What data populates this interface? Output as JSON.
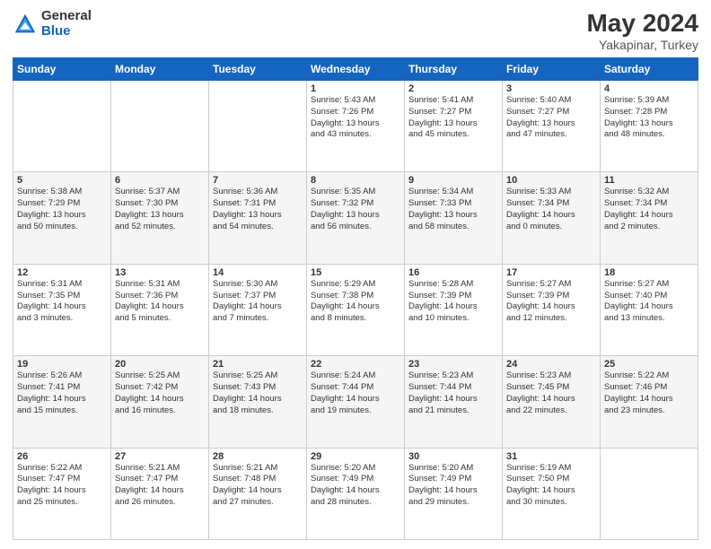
{
  "logo": {
    "general": "General",
    "blue": "Blue"
  },
  "title": "May 2024",
  "subtitle": "Yakapinar, Turkey",
  "days": [
    "Sunday",
    "Monday",
    "Tuesday",
    "Wednesday",
    "Thursday",
    "Friday",
    "Saturday"
  ],
  "weeks": [
    [
      {
        "num": "",
        "text": ""
      },
      {
        "num": "",
        "text": ""
      },
      {
        "num": "",
        "text": ""
      },
      {
        "num": "1",
        "text": "Sunrise: 5:43 AM\nSunset: 7:26 PM\nDaylight: 13 hours\nand 43 minutes."
      },
      {
        "num": "2",
        "text": "Sunrise: 5:41 AM\nSunset: 7:27 PM\nDaylight: 13 hours\nand 45 minutes."
      },
      {
        "num": "3",
        "text": "Sunrise: 5:40 AM\nSunset: 7:27 PM\nDaylight: 13 hours\nand 47 minutes."
      },
      {
        "num": "4",
        "text": "Sunrise: 5:39 AM\nSunset: 7:28 PM\nDaylight: 13 hours\nand 48 minutes."
      }
    ],
    [
      {
        "num": "5",
        "text": "Sunrise: 5:38 AM\nSunset: 7:29 PM\nDaylight: 13 hours\nand 50 minutes."
      },
      {
        "num": "6",
        "text": "Sunrise: 5:37 AM\nSunset: 7:30 PM\nDaylight: 13 hours\nand 52 minutes."
      },
      {
        "num": "7",
        "text": "Sunrise: 5:36 AM\nSunset: 7:31 PM\nDaylight: 13 hours\nand 54 minutes."
      },
      {
        "num": "8",
        "text": "Sunrise: 5:35 AM\nSunset: 7:32 PM\nDaylight: 13 hours\nand 56 minutes."
      },
      {
        "num": "9",
        "text": "Sunrise: 5:34 AM\nSunset: 7:33 PM\nDaylight: 13 hours\nand 58 minutes."
      },
      {
        "num": "10",
        "text": "Sunrise: 5:33 AM\nSunset: 7:34 PM\nDaylight: 14 hours\nand 0 minutes."
      },
      {
        "num": "11",
        "text": "Sunrise: 5:32 AM\nSunset: 7:34 PM\nDaylight: 14 hours\nand 2 minutes."
      }
    ],
    [
      {
        "num": "12",
        "text": "Sunrise: 5:31 AM\nSunset: 7:35 PM\nDaylight: 14 hours\nand 3 minutes."
      },
      {
        "num": "13",
        "text": "Sunrise: 5:31 AM\nSunset: 7:36 PM\nDaylight: 14 hours\nand 5 minutes."
      },
      {
        "num": "14",
        "text": "Sunrise: 5:30 AM\nSunset: 7:37 PM\nDaylight: 14 hours\nand 7 minutes."
      },
      {
        "num": "15",
        "text": "Sunrise: 5:29 AM\nSunset: 7:38 PM\nDaylight: 14 hours\nand 8 minutes."
      },
      {
        "num": "16",
        "text": "Sunrise: 5:28 AM\nSunset: 7:39 PM\nDaylight: 14 hours\nand 10 minutes."
      },
      {
        "num": "17",
        "text": "Sunrise: 5:27 AM\nSunset: 7:39 PM\nDaylight: 14 hours\nand 12 minutes."
      },
      {
        "num": "18",
        "text": "Sunrise: 5:27 AM\nSunset: 7:40 PM\nDaylight: 14 hours\nand 13 minutes."
      }
    ],
    [
      {
        "num": "19",
        "text": "Sunrise: 5:26 AM\nSunset: 7:41 PM\nDaylight: 14 hours\nand 15 minutes."
      },
      {
        "num": "20",
        "text": "Sunrise: 5:25 AM\nSunset: 7:42 PM\nDaylight: 14 hours\nand 16 minutes."
      },
      {
        "num": "21",
        "text": "Sunrise: 5:25 AM\nSunset: 7:43 PM\nDaylight: 14 hours\nand 18 minutes."
      },
      {
        "num": "22",
        "text": "Sunrise: 5:24 AM\nSunset: 7:44 PM\nDaylight: 14 hours\nand 19 minutes."
      },
      {
        "num": "23",
        "text": "Sunrise: 5:23 AM\nSunset: 7:44 PM\nDaylight: 14 hours\nand 21 minutes."
      },
      {
        "num": "24",
        "text": "Sunrise: 5:23 AM\nSunset: 7:45 PM\nDaylight: 14 hours\nand 22 minutes."
      },
      {
        "num": "25",
        "text": "Sunrise: 5:22 AM\nSunset: 7:46 PM\nDaylight: 14 hours\nand 23 minutes."
      }
    ],
    [
      {
        "num": "26",
        "text": "Sunrise: 5:22 AM\nSunset: 7:47 PM\nDaylight: 14 hours\nand 25 minutes."
      },
      {
        "num": "27",
        "text": "Sunrise: 5:21 AM\nSunset: 7:47 PM\nDaylight: 14 hours\nand 26 minutes."
      },
      {
        "num": "28",
        "text": "Sunrise: 5:21 AM\nSunset: 7:48 PM\nDaylight: 14 hours\nand 27 minutes."
      },
      {
        "num": "29",
        "text": "Sunrise: 5:20 AM\nSunset: 7:49 PM\nDaylight: 14 hours\nand 28 minutes."
      },
      {
        "num": "30",
        "text": "Sunrise: 5:20 AM\nSunset: 7:49 PM\nDaylight: 14 hours\nand 29 minutes."
      },
      {
        "num": "31",
        "text": "Sunrise: 5:19 AM\nSunset: 7:50 PM\nDaylight: 14 hours\nand 30 minutes."
      },
      {
        "num": "",
        "text": ""
      }
    ]
  ]
}
